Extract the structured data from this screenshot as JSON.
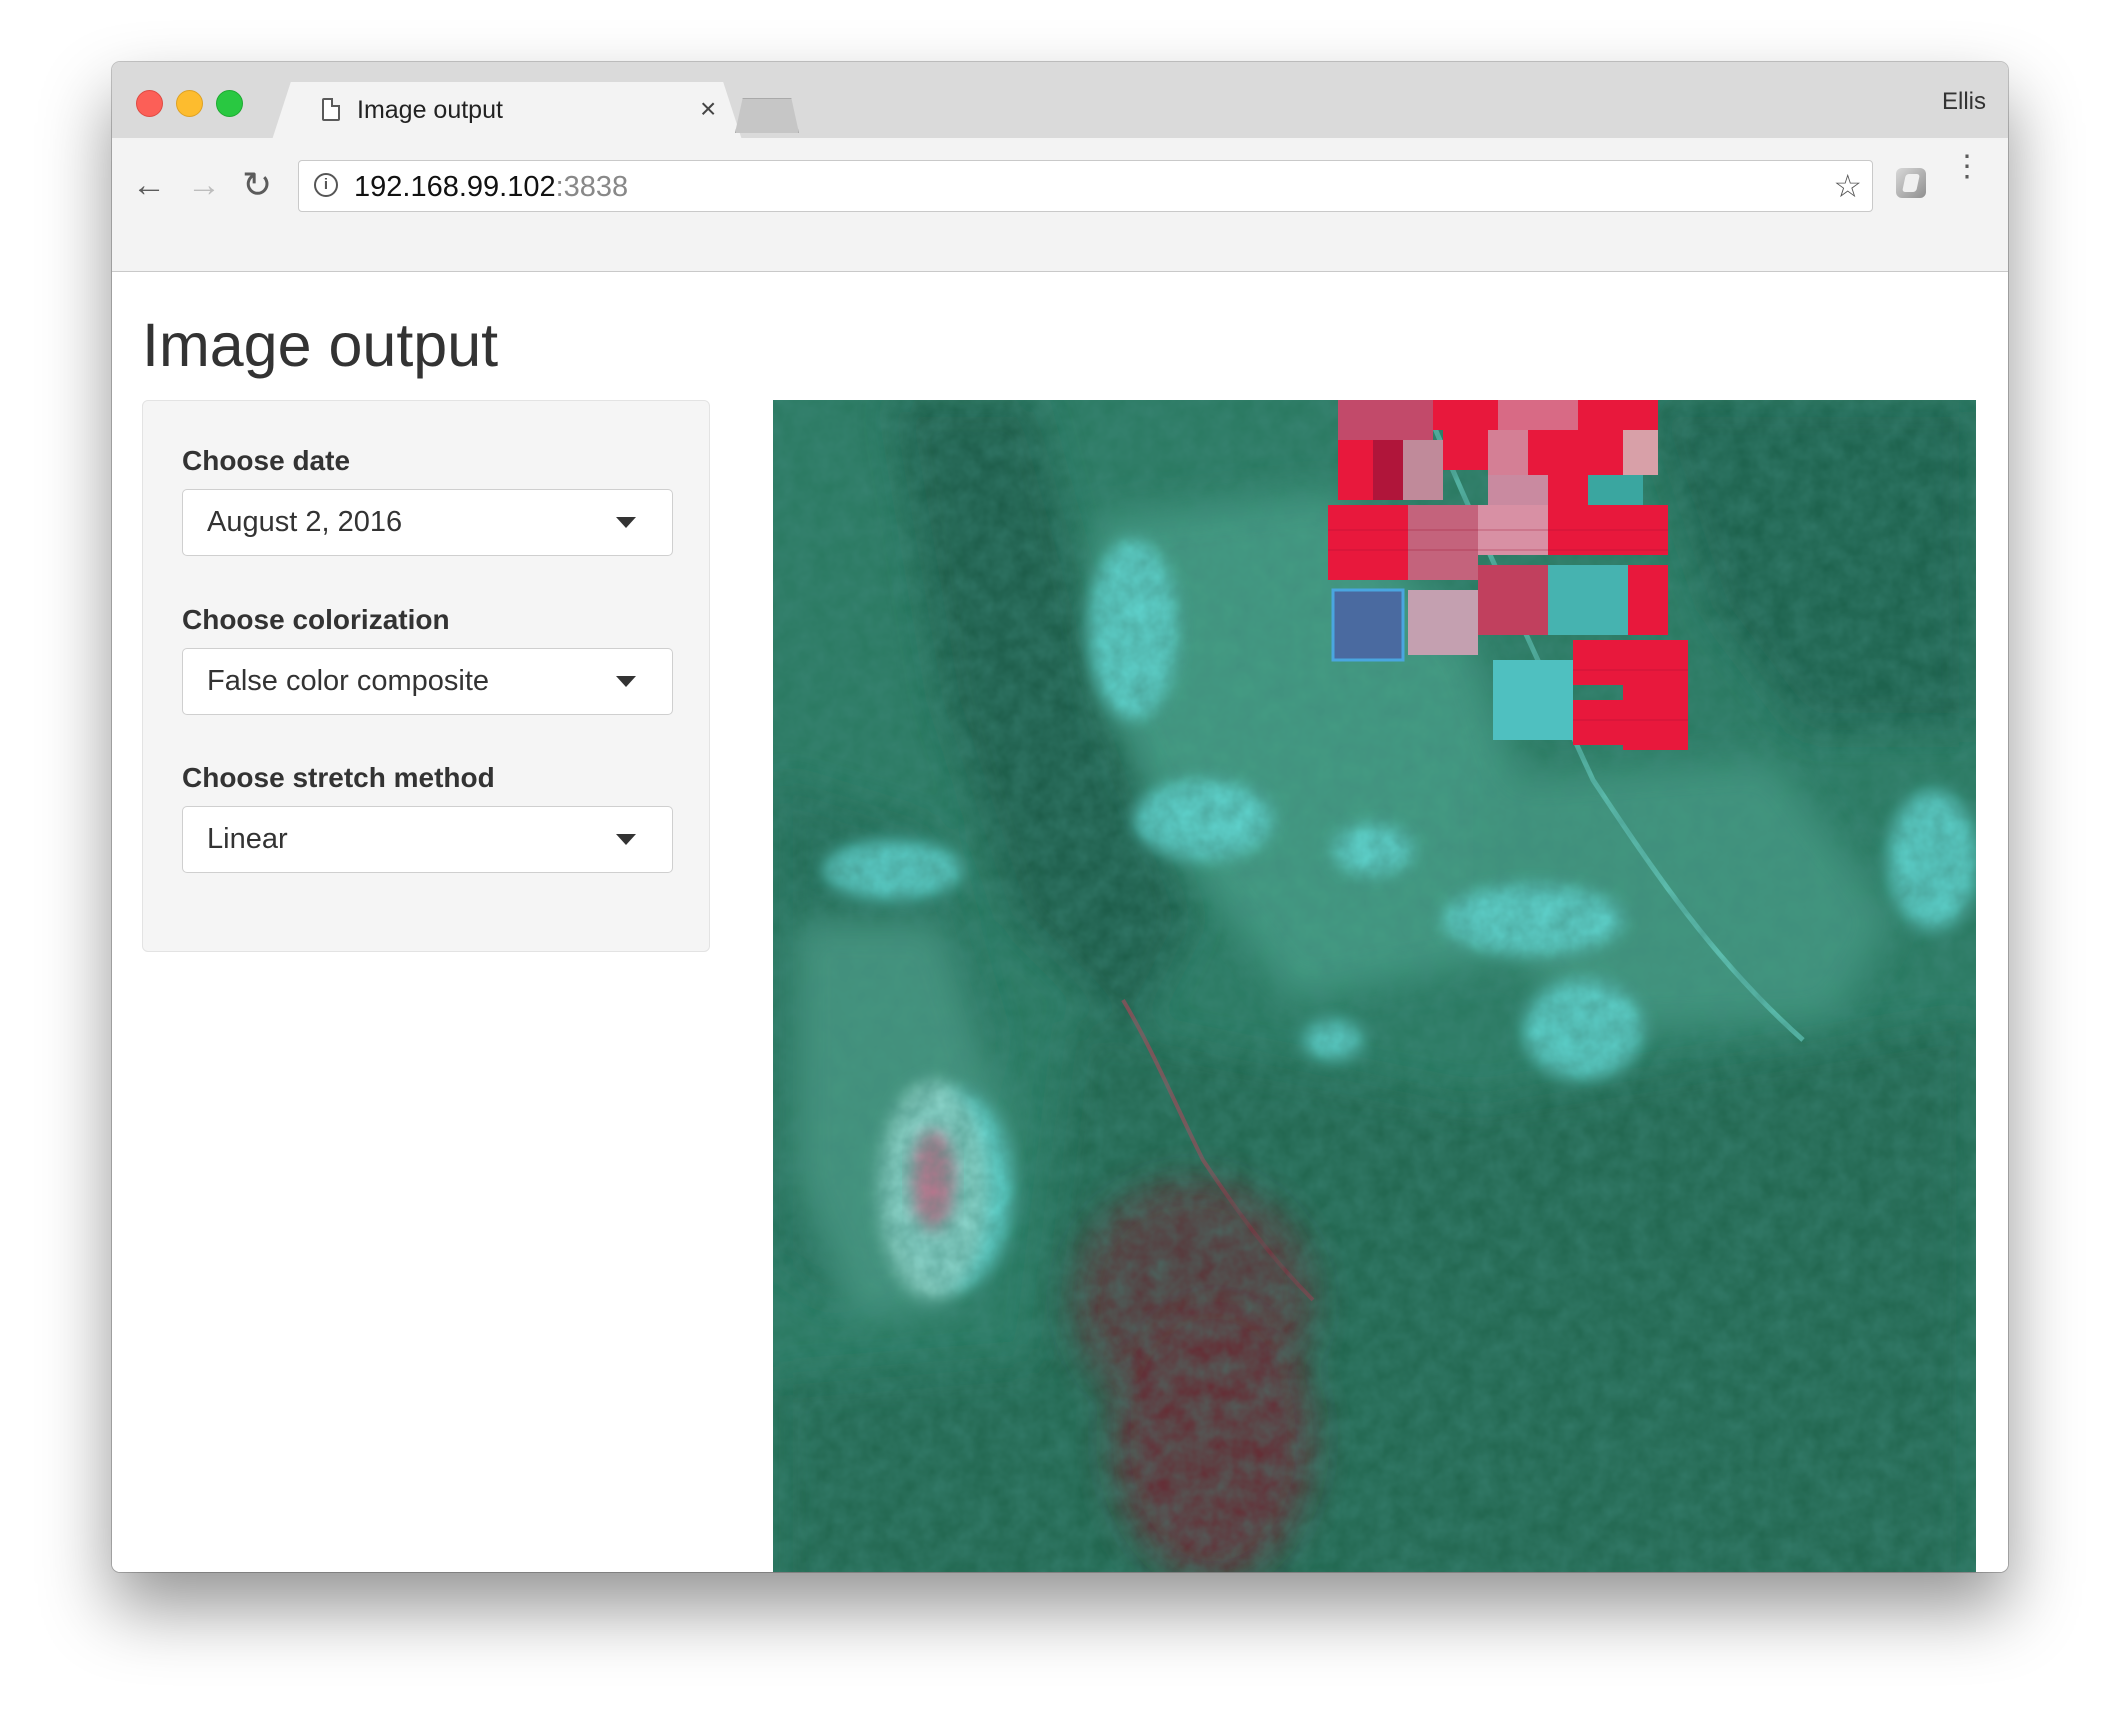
{
  "window": {
    "tab_title": "Image output",
    "user_name": "Ellis",
    "url_host": "192.168.99.102",
    "url_port": ":3838",
    "tab_close": "×"
  },
  "page": {
    "title": "Image output"
  },
  "controls": {
    "date": {
      "label": "Choose date",
      "value": "August 2, 2016"
    },
    "colorization": {
      "label": "Choose colorization",
      "value": "False color composite"
    },
    "stretch": {
      "label": "Choose stretch method",
      "value": "Linear"
    }
  },
  "icons": {
    "back": "arrow-left-icon",
    "forward": "arrow-right-icon",
    "reload": "reload-icon",
    "info": "info-icon",
    "bookmark": "star-icon",
    "extension": "extension-icon",
    "menu": "kebab-menu-icon",
    "tab_file": "file-icon"
  },
  "colors": {
    "vegetation": "#2a7a63",
    "crop_red": "#e8183c",
    "water_cyan": "#5fd6d4"
  }
}
